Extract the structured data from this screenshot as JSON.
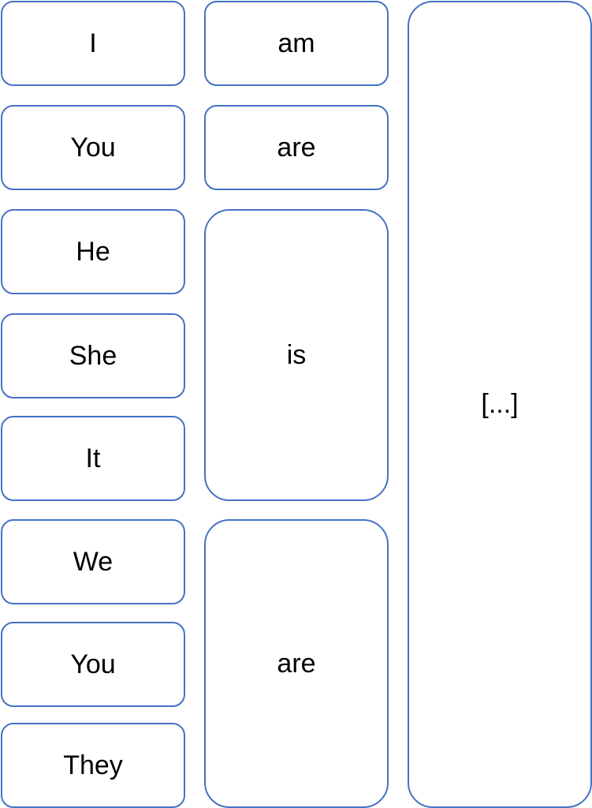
{
  "border_color": "#4472C4",
  "pronouns": [
    "I",
    "You",
    "He",
    "She",
    "It",
    "We",
    "You",
    "They"
  ],
  "verbs": [
    "am",
    "are",
    "is",
    "are"
  ],
  "complement": "[...]"
}
